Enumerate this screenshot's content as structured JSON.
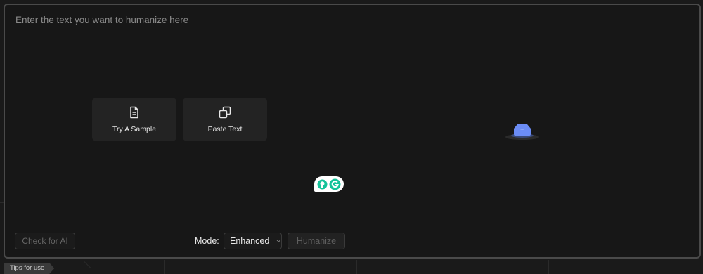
{
  "input": {
    "placeholder": "Enter the text you want to humanize here"
  },
  "actions": {
    "try_sample_label": "Try A Sample",
    "paste_text_label": "Paste Text"
  },
  "bottom_bar": {
    "check_ai_label": "Check for AI",
    "mode_label": "Mode:",
    "mode_value": "Enhanced",
    "humanize_label": "Humanize"
  },
  "footer": {
    "tips_label": "Tips for use"
  },
  "icons": {
    "try_sample": "document-icon",
    "paste_text": "copy-icon",
    "grammarly": "grammarly-icon",
    "empty_output": "empty-box-icon"
  },
  "colors": {
    "accent_empty_icon": "#6b8cf5",
    "grammarly_green": "#15c39a"
  }
}
